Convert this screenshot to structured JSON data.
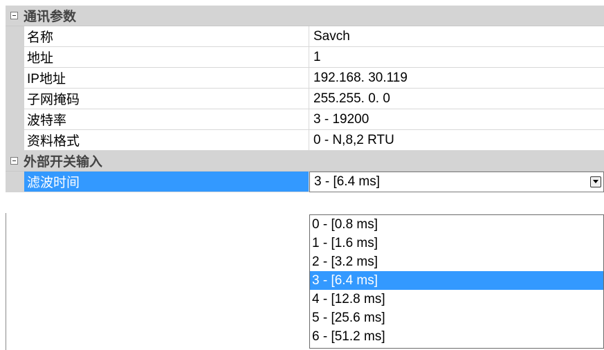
{
  "categories": [
    {
      "label": "通讯参数",
      "properties": [
        {
          "name": "名称",
          "value": "Savch"
        },
        {
          "name": "地址",
          "value": "1"
        },
        {
          "name": "IP地址",
          "value": "192.168. 30.119"
        },
        {
          "name": "子网掩码",
          "value": "255.255.  0.  0"
        },
        {
          "name": "波特率",
          "value": "3 - 19200"
        },
        {
          "name": "资料格式",
          "value": "0 - N,8,2 RTU"
        }
      ]
    },
    {
      "label": "外部开关输入",
      "properties": [
        {
          "name": "滤波时间",
          "value": "3 - [6.4 ms]"
        }
      ]
    }
  ],
  "dropdown": {
    "options": [
      "0 - [0.8 ms]",
      "1 - [1.6 ms]",
      "2 - [3.2 ms]",
      "3 - [6.4 ms]",
      "4 - [12.8 ms]",
      "5 - [25.6 ms]",
      "6 - [51.2 ms]"
    ],
    "selected_index": 3
  },
  "colors": {
    "selection": "#3399ff",
    "category_background": "#d4d4d4"
  },
  "icons": {
    "collapse": "minus-box-icon",
    "dropdown": "chevron-down-icon"
  }
}
